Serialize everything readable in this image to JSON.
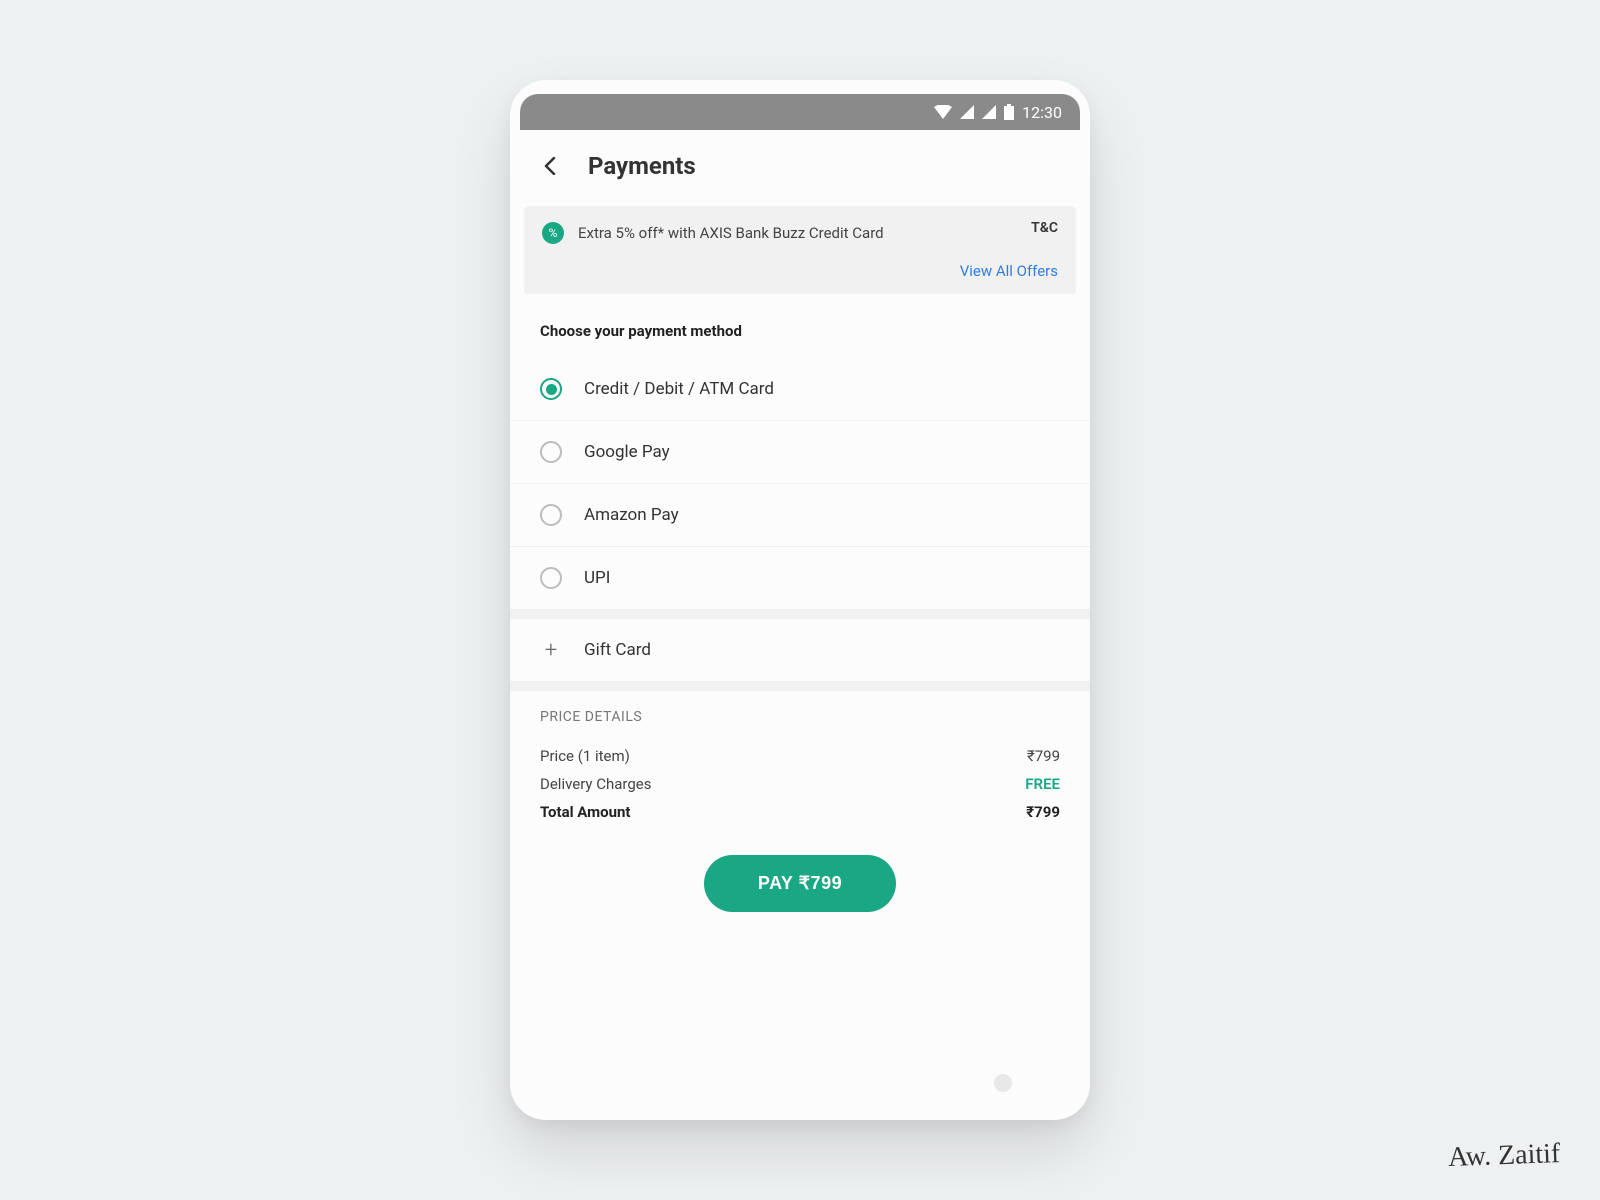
{
  "statusbar": {
    "time": "12:30"
  },
  "header": {
    "title": "Payments"
  },
  "offer": {
    "text": "Extra 5% off* with AXIS Bank Buzz Credit Card",
    "tnc": "T&C",
    "view_all": "View All Offers"
  },
  "payment_methods": {
    "section_label": "Choose your payment method",
    "options": [
      {
        "label": "Credit / Debit / ATM Card",
        "selected": true
      },
      {
        "label": "Google Pay",
        "selected": false
      },
      {
        "label": "Amazon Pay",
        "selected": false
      },
      {
        "label": "UPI",
        "selected": false
      }
    ]
  },
  "gift_card": {
    "label": "Gift Card"
  },
  "price_details": {
    "title": "PRICE DETAILS",
    "lines": [
      {
        "label": "Price (1 item)",
        "value": "₹799"
      },
      {
        "label": "Delivery Charges",
        "value": "FREE",
        "free": true
      }
    ],
    "total_label": "Total Amount",
    "total_value": "₹799"
  },
  "pay_button": {
    "label": "PAY ₹799"
  },
  "signature": "Aw. Zaitif"
}
